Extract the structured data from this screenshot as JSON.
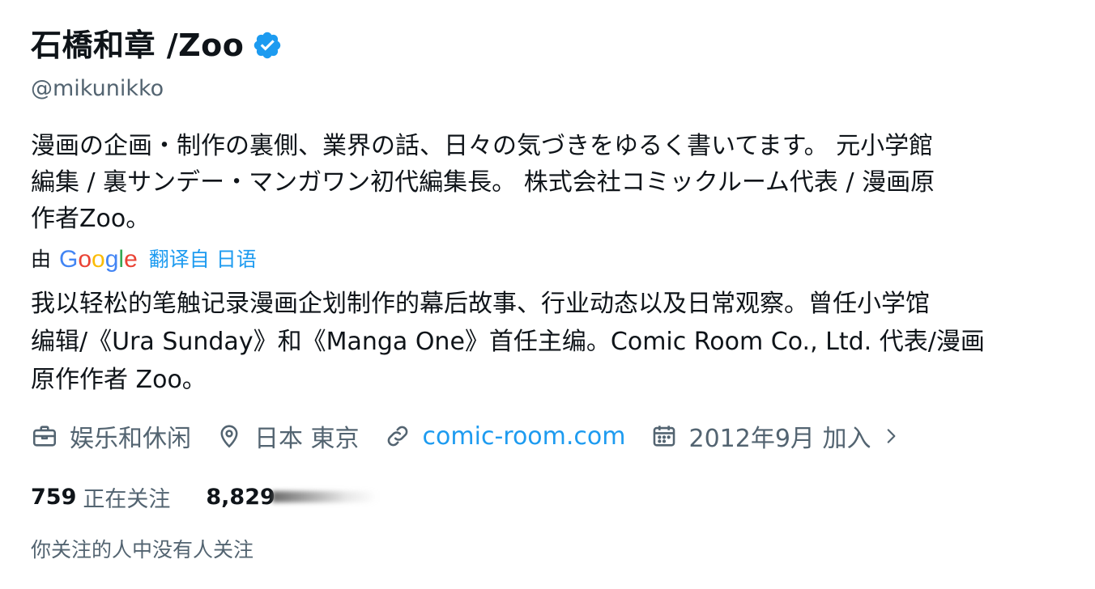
{
  "profile": {
    "display_name": "石橋和章 /Zoo",
    "verified_icon": "verified-badge-icon",
    "handle": "@mikunikko",
    "bio_lines": [
      "漫画の企画・制作の裏側、業界の話、日々の気づきをゆるく書いてます。 元小学館",
      "編集 / 裏サンデー・マンガワン初代編集長。 株式会社コミックルーム代表 / 漫画原",
      "作者Zoo。"
    ],
    "translation": {
      "by_label": "由",
      "provider_logo_letters": [
        "G",
        "o",
        "o",
        "g",
        "l",
        "e"
      ],
      "translate_link": "翻译自 日语"
    },
    "bio_translated_lines": [
      "我以轻松的笔触记录漫画企划制作的幕后故事、行业动态以及日常观察。曾任小学馆",
      "编辑/《Ura Sunday》和《Manga One》首任主编。Comic Room Co., Ltd. 代表/漫画",
      "原作作者 Zoo。"
    ],
    "meta": {
      "category": "娱乐和休闲",
      "category_icon": "briefcase-icon",
      "location": "日本 東京",
      "location_icon": "location-pin-icon",
      "website": "comic-room.com",
      "website_icon": "link-icon",
      "joined": "2012年9月 加入",
      "joined_icon": "calendar-icon",
      "chevron_icon": "chevron-right-icon"
    },
    "following_count": "759",
    "following_label": "正在关注",
    "followers_count_visible": "8,829",
    "followed_by_text": "你关注的人中没有人关注"
  },
  "colors": {
    "text_primary": "#0f1419",
    "text_secondary": "#536471",
    "link": "#1d9bf0",
    "verified": "#1d9bf0"
  }
}
